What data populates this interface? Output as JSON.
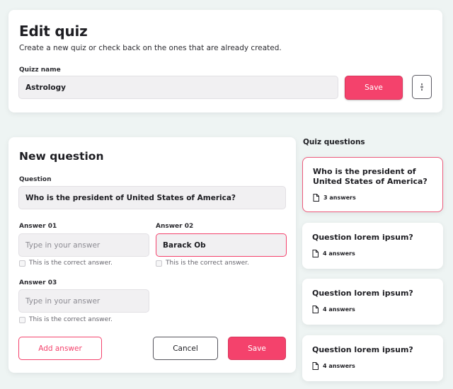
{
  "edit_quiz": {
    "title": "Edit quiz",
    "subtitle": "Create a new quiz or check back on the ones that are already created.",
    "name_label": "Quizz name",
    "name_value": "Astrology",
    "save_label": "Save",
    "more_icon": "more-vertical-icon"
  },
  "new_question": {
    "title": "New question",
    "question_label": "Question",
    "question_value": "Who is the president of United States of America?",
    "answers": [
      {
        "label": "Answer 01",
        "value": "",
        "placeholder": "Type in your answer",
        "correct_label": "This is the correct answer.",
        "checked": false
      },
      {
        "label": "Answer 02",
        "value": "Barack Ob",
        "placeholder": "Type in your answer",
        "correct_label": "This is the correct answer.",
        "checked": false
      },
      {
        "label": "Answer 03",
        "value": "",
        "placeholder": "Type in your answer",
        "correct_label": "This is the correct answer.",
        "checked": false
      }
    ],
    "add_answer_label": "Add answer",
    "cancel_label": "Cancel",
    "save_label": "Save"
  },
  "quiz_questions": {
    "heading": "Quiz questions",
    "items": [
      {
        "title": "Who is the president of United States of America?",
        "answers": "3 answers",
        "selected": true
      },
      {
        "title": "Question lorem ipsum?",
        "answers": "4 answers",
        "selected": false
      },
      {
        "title": "Question lorem ipsum?",
        "answers": "4 answers",
        "selected": false
      },
      {
        "title": "Question lorem ipsum?",
        "answers": "4 answers",
        "selected": false
      }
    ]
  },
  "colors": {
    "accent": "#f4426c",
    "background": "#eef4f3",
    "input_bg": "#f1f0f2"
  }
}
